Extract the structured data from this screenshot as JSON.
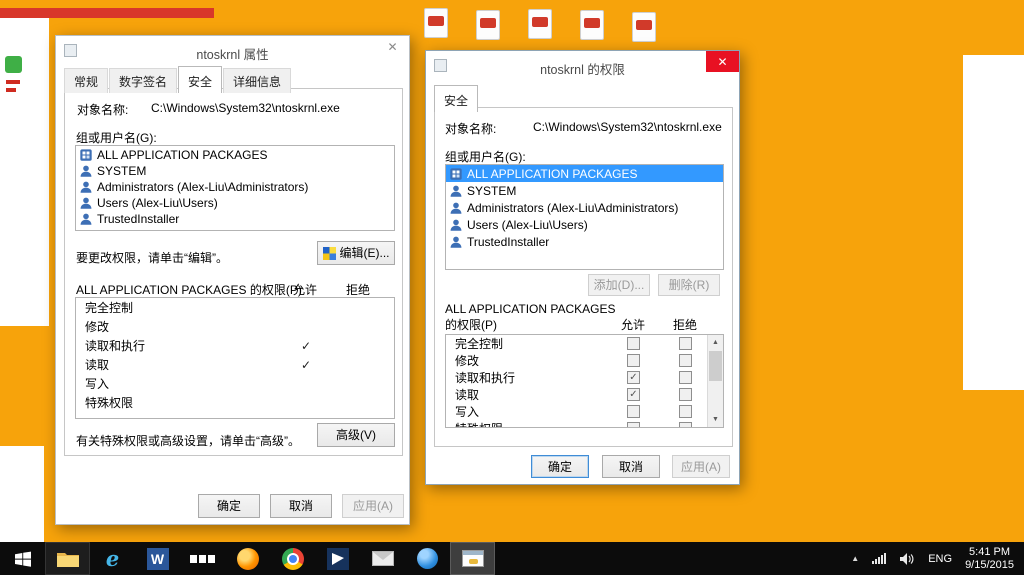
{
  "properties_dialog": {
    "title": "ntoskrnl 属性",
    "tabs": [
      "常规",
      "数字签名",
      "安全",
      "详细信息"
    ],
    "object_label": "对象名称:",
    "object_path": "C:\\Windows\\System32\\ntoskrnl.exe",
    "groups_label": "组或用户名(G):",
    "groups": [
      "ALL APPLICATION PACKAGES",
      "SYSTEM",
      "Administrators (Alex-Liu\\Administrators)",
      "Users (Alex-Liu\\Users)",
      "TrustedInstaller"
    ],
    "edit_hint": "要更改权限，请单击“编辑”。",
    "edit_button": "编辑(E)...",
    "permissions_title": "ALL APPLICATION PACKAGES 的权限(P)",
    "allow_header": "允许",
    "deny_header": "拒绝",
    "permissions": [
      {
        "name": "完全控制",
        "allow": "",
        "deny": ""
      },
      {
        "name": "修改",
        "allow": "",
        "deny": ""
      },
      {
        "name": "读取和执行",
        "allow": "✓",
        "deny": ""
      },
      {
        "name": "读取",
        "allow": "✓",
        "deny": ""
      },
      {
        "name": "写入",
        "allow": "",
        "deny": ""
      },
      {
        "name": "特殊权限",
        "allow": "",
        "deny": ""
      }
    ],
    "advanced_hint": "有关特殊权限或高级设置，请单击“高级”。",
    "advanced_button": "高级(V)",
    "ok_button": "确定",
    "cancel_button": "取消",
    "apply_button": "应用(A)"
  },
  "permissions_dialog": {
    "title": "ntoskrnl 的权限",
    "tab": "安全",
    "object_label": "对象名称:",
    "object_path": "C:\\Windows\\System32\\ntoskrnl.exe",
    "groups_label": "组或用户名(G):",
    "groups": [
      "ALL APPLICATION PACKAGES",
      "SYSTEM",
      "Administrators (Alex-Liu\\Administrators)",
      "Users (Alex-Liu\\Users)",
      "TrustedInstaller"
    ],
    "add_button": "添加(D)...",
    "remove_button": "删除(R)",
    "permissions_title_line1": "ALL APPLICATION PACKAGES",
    "permissions_title_line2": "的权限(P)",
    "allow_header": "允许",
    "deny_header": "拒绝",
    "permissions": [
      {
        "name": "完全控制",
        "allow": "",
        "deny": ""
      },
      {
        "name": "修改",
        "allow": "",
        "deny": ""
      },
      {
        "name": "读取和执行",
        "allow": "✓",
        "deny": ""
      },
      {
        "name": "读取",
        "allow": "✓",
        "deny": ""
      },
      {
        "name": "写入",
        "allow": "",
        "deny": ""
      },
      {
        "name": "特殊权限",
        "allow": "",
        "deny": ""
      }
    ],
    "ok_button": "确定",
    "cancel_button": "取消",
    "apply_button": "应用(A)"
  },
  "taskbar": {
    "language": "ENG",
    "time": "5:41 PM",
    "date": "9/15/2015",
    "tray_chevron": "▲"
  }
}
